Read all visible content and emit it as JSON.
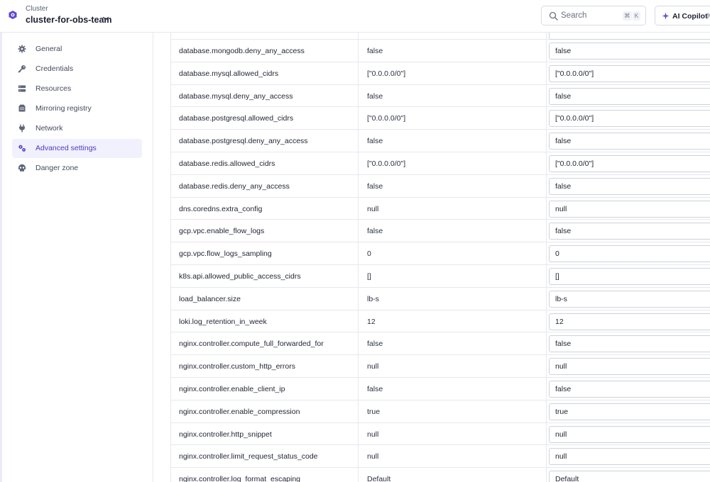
{
  "header": {
    "cluster_label": "Cluster",
    "cluster_name": "cluster-for-obs-team",
    "search_placeholder": "Search",
    "search_kbd": [
      "⌘",
      "K"
    ],
    "copilot_label": "AI Copilot",
    "copilot_kbd": "⌘"
  },
  "sidebar": {
    "items": [
      {
        "label": "General",
        "icon": "gear-icon",
        "active": false
      },
      {
        "label": "Credentials",
        "icon": "key-icon",
        "active": false
      },
      {
        "label": "Resources",
        "icon": "server-icon",
        "active": false
      },
      {
        "label": "Mirroring registry",
        "icon": "registry-icon",
        "active": false
      },
      {
        "label": "Network",
        "icon": "plug-icon",
        "active": false
      },
      {
        "label": "Advanced settings",
        "icon": "gears-icon",
        "active": true
      },
      {
        "label": "Danger zone",
        "icon": "skull-icon",
        "active": false
      }
    ]
  },
  "table": {
    "rows": [
      {
        "key": "database.mongodb.deny_any_access",
        "default": "false",
        "value": "false"
      },
      {
        "key": "database.mysql.allowed_cidrs",
        "default": "[\"0.0.0.0/0\"]",
        "value": "[\"0.0.0.0/0\"]"
      },
      {
        "key": "database.mysql.deny_any_access",
        "default": "false",
        "value": "false"
      },
      {
        "key": "database.postgresql.allowed_cidrs",
        "default": "[\"0.0.0.0/0\"]",
        "value": "[\"0.0.0.0/0\"]"
      },
      {
        "key": "database.postgresql.deny_any_access",
        "default": "false",
        "value": "false"
      },
      {
        "key": "database.redis.allowed_cidrs",
        "default": "[\"0.0.0.0/0\"]",
        "value": "[\"0.0.0.0/0\"]"
      },
      {
        "key": "database.redis.deny_any_access",
        "default": "false",
        "value": "false"
      },
      {
        "key": "dns.coredns.extra_config",
        "default": "null",
        "value": "null"
      },
      {
        "key": "gcp.vpc.enable_flow_logs",
        "default": "false",
        "value": "false"
      },
      {
        "key": "gcp.vpc.flow_logs_sampling",
        "default": "0",
        "value": "0"
      },
      {
        "key": "k8s.api.allowed_public_access_cidrs",
        "default": "[]",
        "value": "[]"
      },
      {
        "key": "load_balancer.size",
        "default": "lb-s",
        "value": "lb-s"
      },
      {
        "key": "loki.log_retention_in_week",
        "default": "12",
        "value": "12"
      },
      {
        "key": "nginx.controller.compute_full_forwarded_for",
        "default": "false",
        "value": "false"
      },
      {
        "key": "nginx.controller.custom_http_errors",
        "default": "null",
        "value": "null"
      },
      {
        "key": "nginx.controller.enable_client_ip",
        "default": "false",
        "value": "false"
      },
      {
        "key": "nginx.controller.enable_compression",
        "default": "true",
        "value": "true"
      },
      {
        "key": "nginx.controller.http_snippet",
        "default": "null",
        "value": "null"
      },
      {
        "key": "nginx.controller.limit_request_status_code",
        "default": "null",
        "value": "null"
      },
      {
        "key": "nginx.controller.log_format_escaping",
        "default": "Default",
        "value": "Default"
      }
    ]
  },
  "colors": {
    "accent": "#4b3bc6",
    "active_bg": "#f1f0fd",
    "border": "#e7e8ee"
  }
}
